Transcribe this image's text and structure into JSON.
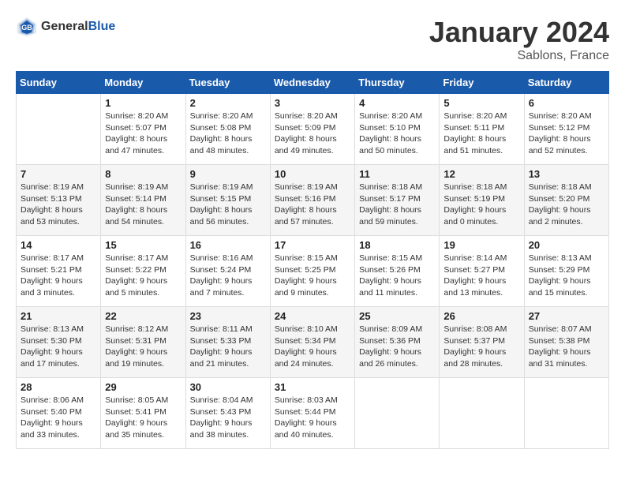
{
  "header": {
    "logo_general": "General",
    "logo_blue": "Blue",
    "month": "January 2024",
    "location": "Sablons, France"
  },
  "days_of_week": [
    "Sunday",
    "Monday",
    "Tuesday",
    "Wednesday",
    "Thursday",
    "Friday",
    "Saturday"
  ],
  "weeks": [
    [
      {
        "day": "",
        "info": ""
      },
      {
        "day": "1",
        "info": "Sunrise: 8:20 AM\nSunset: 5:07 PM\nDaylight: 8 hours\nand 47 minutes."
      },
      {
        "day": "2",
        "info": "Sunrise: 8:20 AM\nSunset: 5:08 PM\nDaylight: 8 hours\nand 48 minutes."
      },
      {
        "day": "3",
        "info": "Sunrise: 8:20 AM\nSunset: 5:09 PM\nDaylight: 8 hours\nand 49 minutes."
      },
      {
        "day": "4",
        "info": "Sunrise: 8:20 AM\nSunset: 5:10 PM\nDaylight: 8 hours\nand 50 minutes."
      },
      {
        "day": "5",
        "info": "Sunrise: 8:20 AM\nSunset: 5:11 PM\nDaylight: 8 hours\nand 51 minutes."
      },
      {
        "day": "6",
        "info": "Sunrise: 8:20 AM\nSunset: 5:12 PM\nDaylight: 8 hours\nand 52 minutes."
      }
    ],
    [
      {
        "day": "7",
        "info": "Sunrise: 8:19 AM\nSunset: 5:13 PM\nDaylight: 8 hours\nand 53 minutes."
      },
      {
        "day": "8",
        "info": "Sunrise: 8:19 AM\nSunset: 5:14 PM\nDaylight: 8 hours\nand 54 minutes."
      },
      {
        "day": "9",
        "info": "Sunrise: 8:19 AM\nSunset: 5:15 PM\nDaylight: 8 hours\nand 56 minutes."
      },
      {
        "day": "10",
        "info": "Sunrise: 8:19 AM\nSunset: 5:16 PM\nDaylight: 8 hours\nand 57 minutes."
      },
      {
        "day": "11",
        "info": "Sunrise: 8:18 AM\nSunset: 5:17 PM\nDaylight: 8 hours\nand 59 minutes."
      },
      {
        "day": "12",
        "info": "Sunrise: 8:18 AM\nSunset: 5:19 PM\nDaylight: 9 hours\nand 0 minutes."
      },
      {
        "day": "13",
        "info": "Sunrise: 8:18 AM\nSunset: 5:20 PM\nDaylight: 9 hours\nand 2 minutes."
      }
    ],
    [
      {
        "day": "14",
        "info": "Sunrise: 8:17 AM\nSunset: 5:21 PM\nDaylight: 9 hours\nand 3 minutes."
      },
      {
        "day": "15",
        "info": "Sunrise: 8:17 AM\nSunset: 5:22 PM\nDaylight: 9 hours\nand 5 minutes."
      },
      {
        "day": "16",
        "info": "Sunrise: 8:16 AM\nSunset: 5:24 PM\nDaylight: 9 hours\nand 7 minutes."
      },
      {
        "day": "17",
        "info": "Sunrise: 8:15 AM\nSunset: 5:25 PM\nDaylight: 9 hours\nand 9 minutes."
      },
      {
        "day": "18",
        "info": "Sunrise: 8:15 AM\nSunset: 5:26 PM\nDaylight: 9 hours\nand 11 minutes."
      },
      {
        "day": "19",
        "info": "Sunrise: 8:14 AM\nSunset: 5:27 PM\nDaylight: 9 hours\nand 13 minutes."
      },
      {
        "day": "20",
        "info": "Sunrise: 8:13 AM\nSunset: 5:29 PM\nDaylight: 9 hours\nand 15 minutes."
      }
    ],
    [
      {
        "day": "21",
        "info": "Sunrise: 8:13 AM\nSunset: 5:30 PM\nDaylight: 9 hours\nand 17 minutes."
      },
      {
        "day": "22",
        "info": "Sunrise: 8:12 AM\nSunset: 5:31 PM\nDaylight: 9 hours\nand 19 minutes."
      },
      {
        "day": "23",
        "info": "Sunrise: 8:11 AM\nSunset: 5:33 PM\nDaylight: 9 hours\nand 21 minutes."
      },
      {
        "day": "24",
        "info": "Sunrise: 8:10 AM\nSunset: 5:34 PM\nDaylight: 9 hours\nand 24 minutes."
      },
      {
        "day": "25",
        "info": "Sunrise: 8:09 AM\nSunset: 5:36 PM\nDaylight: 9 hours\nand 26 minutes."
      },
      {
        "day": "26",
        "info": "Sunrise: 8:08 AM\nSunset: 5:37 PM\nDaylight: 9 hours\nand 28 minutes."
      },
      {
        "day": "27",
        "info": "Sunrise: 8:07 AM\nSunset: 5:38 PM\nDaylight: 9 hours\nand 31 minutes."
      }
    ],
    [
      {
        "day": "28",
        "info": "Sunrise: 8:06 AM\nSunset: 5:40 PM\nDaylight: 9 hours\nand 33 minutes."
      },
      {
        "day": "29",
        "info": "Sunrise: 8:05 AM\nSunset: 5:41 PM\nDaylight: 9 hours\nand 35 minutes."
      },
      {
        "day": "30",
        "info": "Sunrise: 8:04 AM\nSunset: 5:43 PM\nDaylight: 9 hours\nand 38 minutes."
      },
      {
        "day": "31",
        "info": "Sunrise: 8:03 AM\nSunset: 5:44 PM\nDaylight: 9 hours\nand 40 minutes."
      },
      {
        "day": "",
        "info": ""
      },
      {
        "day": "",
        "info": ""
      },
      {
        "day": "",
        "info": ""
      }
    ]
  ]
}
